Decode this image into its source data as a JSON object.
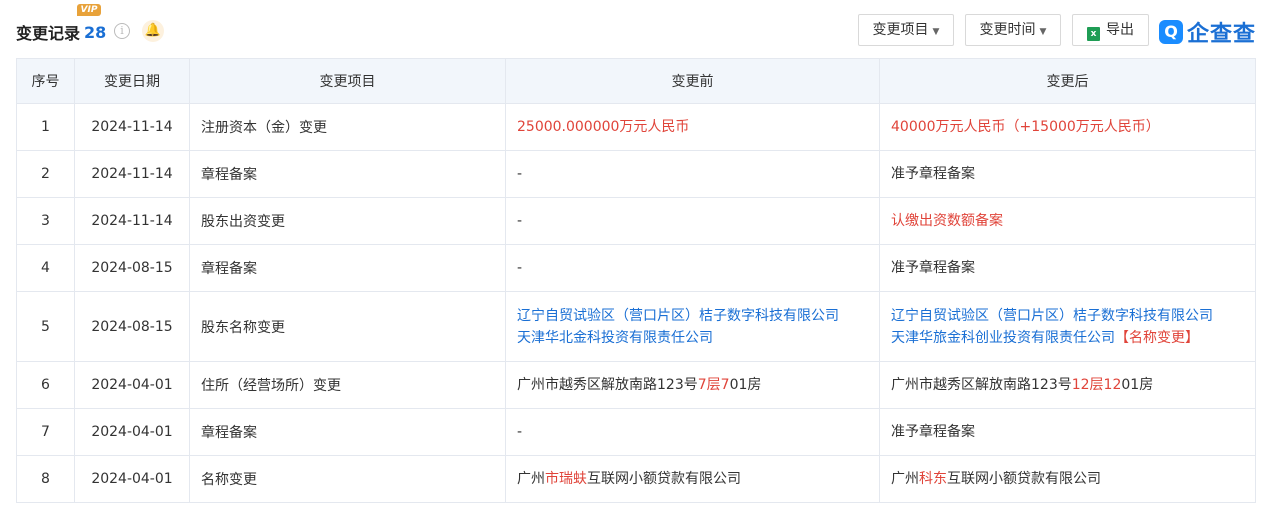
{
  "header": {
    "title": "变更记录",
    "count": "28",
    "vip_badge": "VIP",
    "info_glyph": "i",
    "bell_glyph": "🔔",
    "buttons": {
      "item_filter": "变更项目",
      "time_filter": "变更时间",
      "export": "导出"
    },
    "brand": "企查查",
    "brand_icon_glyph": "Q"
  },
  "table": {
    "columns": [
      "序号",
      "变更日期",
      "变更项目",
      "变更前",
      "变更后"
    ],
    "rows": [
      {
        "no": "1",
        "date": "2024-11-14",
        "item": "注册资本（金）变更",
        "before": [
          [
            {
              "t": "25000.000000万元人民币",
              "c": "red"
            }
          ]
        ],
        "after": [
          [
            {
              "t": "40000万元人民币（+15000万元人民币）",
              "c": "red"
            }
          ]
        ]
      },
      {
        "no": "2",
        "date": "2024-11-14",
        "item": "章程备案",
        "before": [
          [
            {
              "t": "-",
              "c": ""
            }
          ]
        ],
        "after": [
          [
            {
              "t": "准予章程备案",
              "c": ""
            }
          ]
        ]
      },
      {
        "no": "3",
        "date": "2024-11-14",
        "item": "股东出资变更",
        "before": [
          [
            {
              "t": "-",
              "c": ""
            }
          ]
        ],
        "after": [
          [
            {
              "t": "认缴出资数额备案",
              "c": "red"
            }
          ]
        ]
      },
      {
        "no": "4",
        "date": "2024-08-15",
        "item": "章程备案",
        "before": [
          [
            {
              "t": "-",
              "c": ""
            }
          ]
        ],
        "after": [
          [
            {
              "t": "准予章程备案",
              "c": ""
            }
          ]
        ]
      },
      {
        "no": "5",
        "date": "2024-08-15",
        "item": "股东名称变更",
        "before": [
          [
            {
              "t": "辽宁自贸试验区（营口片区）桔子数字科技有限公司",
              "c": "blue"
            }
          ],
          [
            {
              "t": "天津华北金科投资有限责任公司",
              "c": "blue"
            }
          ]
        ],
        "after": [
          [
            {
              "t": "辽宁自贸试验区（营口片区）桔子数字科技有限公司",
              "c": "blue"
            }
          ],
          [
            {
              "t": "天津华旅金科创业投资有限责任公司",
              "c": "blue"
            },
            {
              "t": "【名称变更】",
              "c": "red"
            }
          ]
        ]
      },
      {
        "no": "6",
        "date": "2024-04-01",
        "item": "住所（经营场所）变更",
        "before": [
          [
            {
              "t": "广州市越秀区解放南路123号",
              "c": ""
            },
            {
              "t": "7层7",
              "c": "red"
            },
            {
              "t": "01房",
              "c": ""
            }
          ]
        ],
        "after": [
          [
            {
              "t": "广州市越秀区解放南路123号",
              "c": ""
            },
            {
              "t": "12层12",
              "c": "red"
            },
            {
              "t": "01房",
              "c": ""
            }
          ]
        ]
      },
      {
        "no": "7",
        "date": "2024-04-01",
        "item": "章程备案",
        "before": [
          [
            {
              "t": "-",
              "c": ""
            }
          ]
        ],
        "after": [
          [
            {
              "t": "准予章程备案",
              "c": ""
            }
          ]
        ]
      },
      {
        "no": "8",
        "date": "2024-04-01",
        "item": "名称变更",
        "before": [
          [
            {
              "t": "广州",
              "c": ""
            },
            {
              "t": "市瑞蚨",
              "c": "red"
            },
            {
              "t": "互联网小额贷款有限公司",
              "c": ""
            }
          ]
        ],
        "after": [
          [
            {
              "t": "广州",
              "c": ""
            },
            {
              "t": "科东",
              "c": "red"
            },
            {
              "t": "互联网小额贷款有限公司",
              "c": ""
            }
          ]
        ]
      }
    ]
  },
  "colors": {
    "accent_blue": "#1a6fd4",
    "highlight_red": "#e0443a",
    "header_bg": "#f2f6fb",
    "vip_gold": "#e8a23a"
  },
  "icons": {
    "info": "info-icon",
    "bell": "bell-icon",
    "excel": "excel-icon",
    "brand": "qcc-logo-icon"
  }
}
